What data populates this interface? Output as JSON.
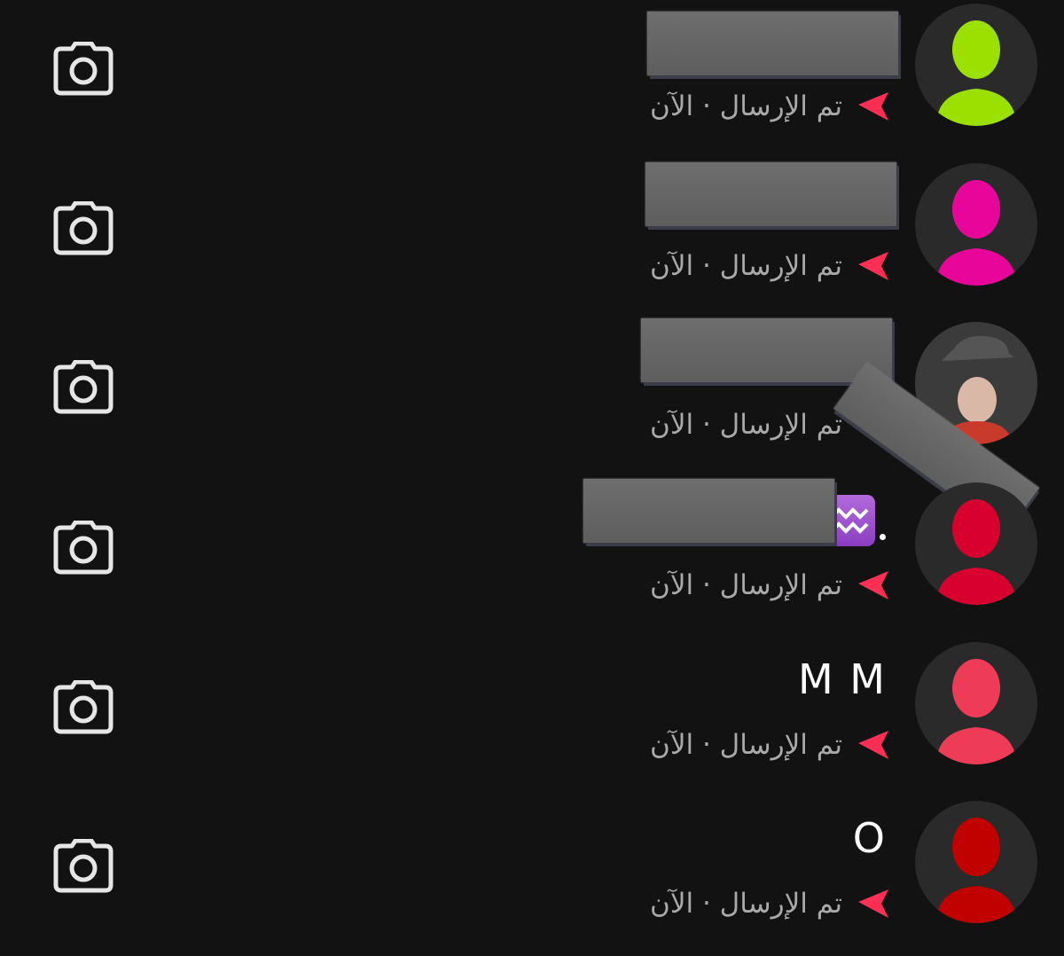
{
  "status_text": "تم الإرسال · الآن",
  "colors": {
    "background": "#121212",
    "sent_arrow": "#ff2e55",
    "status_text": "#a9a9a9",
    "redaction": "#666666"
  },
  "icons": {
    "camera": "camera-icon",
    "sent": "sent-arrow-icon",
    "avatar": "person-silhouette-icon",
    "emoji": "aquarius-emoji-icon"
  },
  "conversations": [
    {
      "name": "",
      "name_redacted": true,
      "avatar_color": "#9be000",
      "status": "تم الإرسال · الآن"
    },
    {
      "name": "",
      "name_redacted": true,
      "avatar_color": "#e8069a",
      "status": "تم الإرسال · الآن"
    },
    {
      "name": "",
      "name_redacted": true,
      "avatar_color": "custom-photo",
      "status": "تم الإرسال · الآن"
    },
    {
      "name": ".",
      "name_redacted": true,
      "name_suffix_icon": "aquarius-emoji-icon",
      "avatar_color": "#d8002e",
      "status": "تم الإرسال · الآن"
    },
    {
      "name": "M M",
      "name_redacted": false,
      "avatar_color": "#ee3b58",
      "status": "تم الإرسال · الآن"
    },
    {
      "name": "O",
      "name_redacted": false,
      "avatar_color": "#c10000",
      "status": "تم الإرسال · الآن"
    }
  ]
}
